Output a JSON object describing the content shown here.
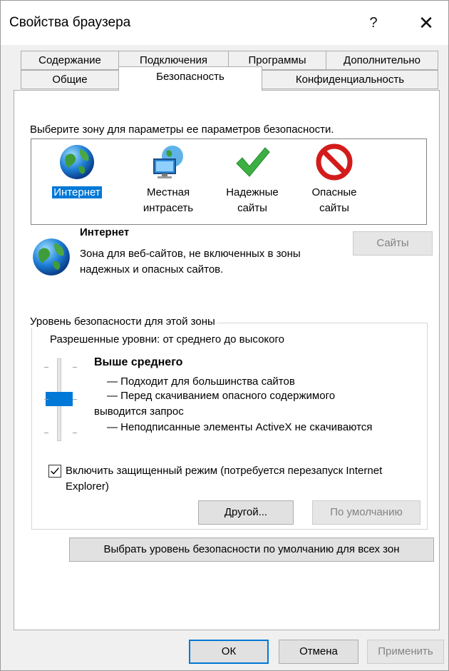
{
  "window": {
    "title": "Свойства браузера",
    "help_glyph": "?",
    "close_glyph": "✕"
  },
  "tabs": {
    "row1": [
      "Содержание",
      "Подключения",
      "Программы",
      "Дополнительно"
    ],
    "row2": [
      "Общие",
      "Безопасность",
      "Конфиденциальность"
    ],
    "active": "Безопасность"
  },
  "zones": {
    "prompt": "Выберите зону для параметры ее параметров безопасности.",
    "items": [
      {
        "label": "Интернет",
        "icon": "globe-icon",
        "selected": true
      },
      {
        "label": "Местная интрасеть",
        "icon": "intranet-icon",
        "selected": false
      },
      {
        "label": "Надежные сайты",
        "icon": "checkmark-icon",
        "selected": false
      },
      {
        "label": "Опасные сайты",
        "icon": "no-entry-icon",
        "selected": false
      }
    ]
  },
  "zone_info": {
    "title": "Интернет",
    "description": "Зона для веб-сайтов, не включенных в зоны надежных и опасных сайтов.",
    "sites_button": "Сайты",
    "icon": "globe-icon"
  },
  "security_level": {
    "legend": "Уровень безопасности для этой зоны",
    "allowed": "Разрешенные уровни: от среднего до высокого",
    "level_name": "Выше среднего",
    "level_fraction": 0.5,
    "lines": [
      "— Подходит для большинства сайтов",
      "— Перед скачиванием опасного содержимого",
      "выводится запрос",
      "— Неподписанные элементы ActiveX не скачиваются"
    ],
    "protected_mode_label": "Включить защищенный режим (потребуется перезапуск Internet Explorer)",
    "protected_mode_checked": true,
    "custom_button": "Другой...",
    "default_button": "По умолчанию"
  },
  "reset_all_button": "Выбрать уровень безопасности по умолчанию для всех зон",
  "footer": {
    "ok": "ОК",
    "cancel": "Отмена",
    "apply": "Применить"
  },
  "colors": {
    "accent": "#0078d7",
    "disabled_text": "#838383"
  }
}
